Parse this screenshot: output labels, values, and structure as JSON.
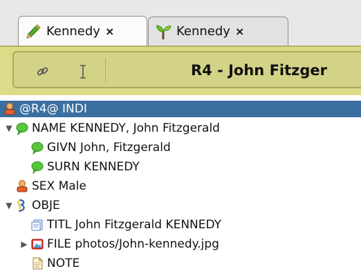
{
  "tabs": [
    {
      "label": "Kennedy",
      "close": "×",
      "icon": "pencil-icon"
    },
    {
      "label": "Kennedy",
      "close": "×",
      "icon": "tree-icon"
    }
  ],
  "header": {
    "title": "R4 - John Fitzger",
    "buttons": [
      {
        "icon": "link-icon"
      },
      {
        "icon": "text-cursor-icon"
      }
    ]
  },
  "tree": [
    {
      "text": "@R4@ INDI",
      "icon": "person-icon",
      "selected": true
    },
    {
      "text": "NAME KENNEDY, John Fitzgerald",
      "icon": "speech-bubble-icon",
      "toggle": "▼"
    },
    {
      "text": "GIVN John, Fitzgerald",
      "icon": "speech-bubble-icon"
    },
    {
      "text": "SURN KENNEDY",
      "icon": "speech-bubble-icon"
    },
    {
      "text": "SEX Male",
      "icon": "person-icon"
    },
    {
      "text": "OBJE",
      "icon": "media-object-icon",
      "toggle": "▼"
    },
    {
      "text": "TITL John Fitzgerald KENNEDY",
      "icon": "title-icon"
    },
    {
      "text": "FILE photos/John-kennedy.jpg",
      "icon": "image-file-icon",
      "toggle": "▶"
    },
    {
      "text": "NOTE",
      "icon": "note-icon"
    }
  ],
  "colors": {
    "header_bg": "#dcdc88",
    "selection": "#3b6fa0",
    "tag_green": "#3fbf3f"
  }
}
